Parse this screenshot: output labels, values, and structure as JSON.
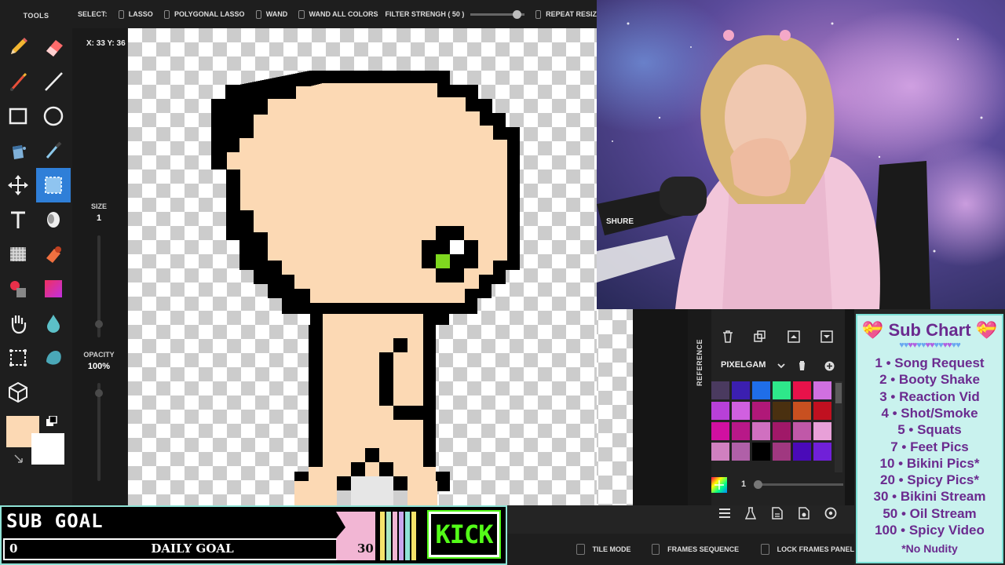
{
  "tools": {
    "title": "TOOLS"
  },
  "toolbar": {
    "select_label": "SELECT:",
    "lasso_label": "LASSO",
    "polygonal_lasso_label": "POLYGONAL LASSO",
    "wand_label": "WAND",
    "wand_all_colors_label": "WAND ALL COLORS",
    "filter_strength_label": "FILTER STRENGH ( 50 )",
    "filter_strength_value": 50,
    "repeat_label": "REPEAT RESIZ"
  },
  "status": {
    "coords": "X: 33 Y: 36"
  },
  "brush": {
    "size_label": "SIZE",
    "size_value": "1",
    "opacity_label": "OPACITY",
    "opacity_value": "100%"
  },
  "colors": {
    "primary": "#fcd9b4",
    "secondary": "#ffffff",
    "accent": "#2f7fd8"
  },
  "reference": {
    "label": "REFERENCE"
  },
  "palette": {
    "name": "PIXELGAM",
    "swatches": [
      "#4a3a5f",
      "#3b1fb0",
      "#1f6ee8",
      "#2ee88a",
      "#e8124a",
      "#d070e0",
      "#b840d8",
      "#d060e0",
      "#b01878",
      "#4a3010",
      "#c85020",
      "#c01020",
      "#d010a0",
      "#b81888",
      "#d070c0",
      "#a01868",
      "#c058a8",
      "#e8a0d8",
      "#d080c0",
      "#b060a8",
      "#000000",
      "#a03880",
      "#4a0ab8",
      "#7020d8"
    ],
    "size_value": "1"
  },
  "bottom_bar": {
    "tile_mode_label": "TILE MODE",
    "frames_sequence_label": "FRAMES SEQUENCE",
    "lock_frames_label": "LOCK FRAMES PANEL"
  },
  "sub_goal": {
    "title": "SUB GOAL",
    "start": "0",
    "label": "DAILY GOAL",
    "end": "30",
    "platform": "KICK"
  },
  "sub_chart": {
    "title": "Sub Chart",
    "items": [
      "1 • Song Request",
      "2 • Booty Shake",
      "3 • Reaction Vid",
      "4 • Shot/Smoke",
      "5 • Squats",
      "7 • Feet Pics",
      "10 • Bikini Pics*",
      "20 • Spicy Pics*",
      "30 • Bikini Stream",
      "50 • Oil Stream",
      "100 • Spicy Video"
    ],
    "note": "*No Nudity"
  },
  "webcam": {
    "mic_brand": "SHURE"
  }
}
